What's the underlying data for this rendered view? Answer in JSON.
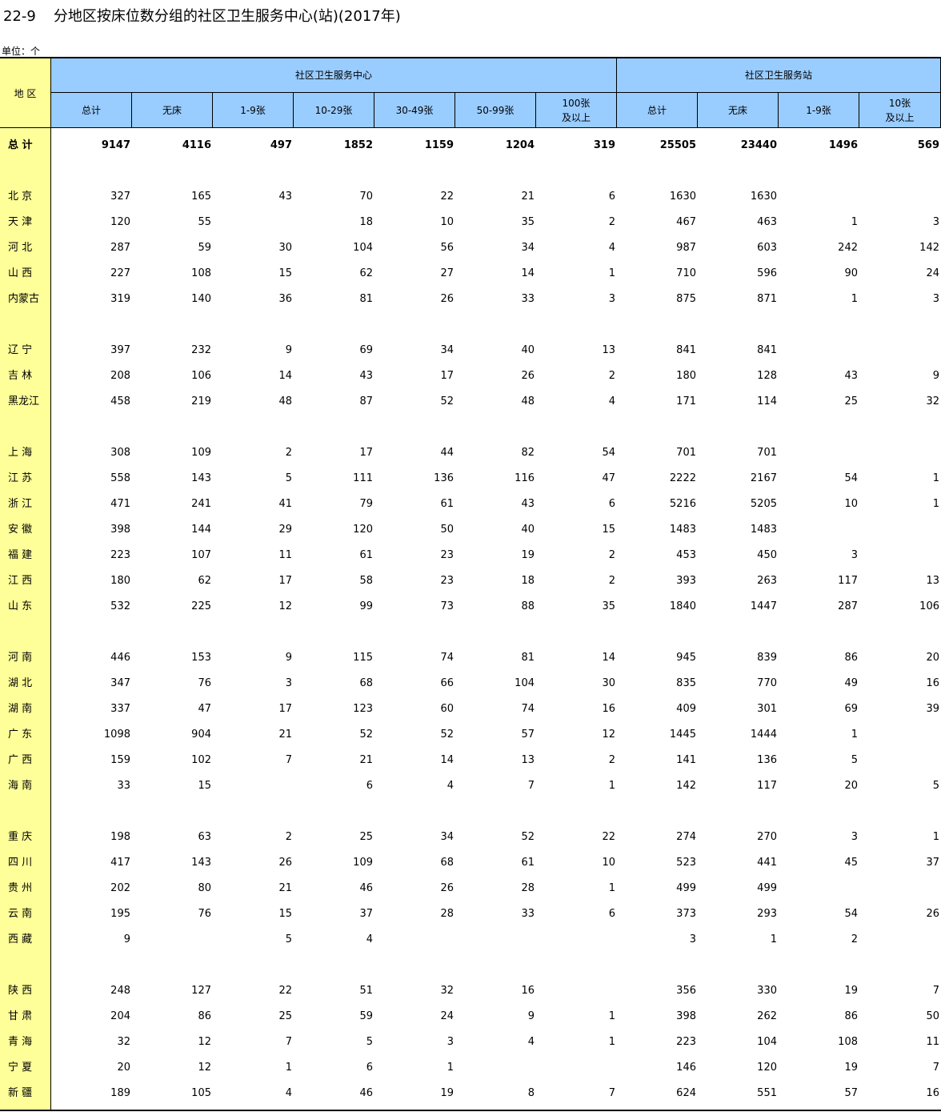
{
  "title": {
    "number": "22-9",
    "text": "分地区按床位数分组的社区卫生服务中心(站)(2017年)"
  },
  "unit": "单位：个",
  "header": {
    "region": "地 区",
    "groups": [
      "社区卫生服务中心",
      "社区卫生服务站"
    ],
    "center_cols": [
      "总计",
      "无床",
      "1-9张",
      "10-29张",
      "30-49张",
      "50-99张",
      "100张\n及以上"
    ],
    "station_cols": [
      "总计",
      "无床",
      "1-9张",
      "10张\n及以上"
    ]
  },
  "rows": [
    {
      "name": "总 计",
      "values": [
        "9147",
        "4116",
        "497",
        "1852",
        "1159",
        "1204",
        "319",
        "25505",
        "23440",
        "1496",
        "569"
      ]
    },
    {
      "name": "北 京",
      "values": [
        "327",
        "165",
        "43",
        "70",
        "22",
        "21",
        "6",
        "1630",
        "1630",
        "",
        ""
      ]
    },
    {
      "name": "天 津",
      "values": [
        "120",
        "55",
        "",
        "18",
        "10",
        "35",
        "2",
        "467",
        "463",
        "1",
        "3"
      ]
    },
    {
      "name": "河 北",
      "values": [
        "287",
        "59",
        "30",
        "104",
        "56",
        "34",
        "4",
        "987",
        "603",
        "242",
        "142"
      ]
    },
    {
      "name": "山 西",
      "values": [
        "227",
        "108",
        "15",
        "62",
        "27",
        "14",
        "1",
        "710",
        "596",
        "90",
        "24"
      ]
    },
    {
      "name": "内蒙古",
      "values": [
        "319",
        "140",
        "36",
        "81",
        "26",
        "33",
        "3",
        "875",
        "871",
        "1",
        "3"
      ]
    },
    {
      "name": "辽 宁",
      "values": [
        "397",
        "232",
        "9",
        "69",
        "34",
        "40",
        "13",
        "841",
        "841",
        "",
        ""
      ]
    },
    {
      "name": "吉 林",
      "values": [
        "208",
        "106",
        "14",
        "43",
        "17",
        "26",
        "2",
        "180",
        "128",
        "43",
        "9"
      ]
    },
    {
      "name": "黑龙江",
      "values": [
        "458",
        "219",
        "48",
        "87",
        "52",
        "48",
        "4",
        "171",
        "114",
        "25",
        "32"
      ]
    },
    {
      "name": "上 海",
      "values": [
        "308",
        "109",
        "2",
        "17",
        "44",
        "82",
        "54",
        "701",
        "701",
        "",
        ""
      ]
    },
    {
      "name": "江 苏",
      "values": [
        "558",
        "143",
        "5",
        "111",
        "136",
        "116",
        "47",
        "2222",
        "2167",
        "54",
        "1"
      ]
    },
    {
      "name": "浙 江",
      "values": [
        "471",
        "241",
        "41",
        "79",
        "61",
        "43",
        "6",
        "5216",
        "5205",
        "10",
        "1"
      ]
    },
    {
      "name": "安 徽",
      "values": [
        "398",
        "144",
        "29",
        "120",
        "50",
        "40",
        "15",
        "1483",
        "1483",
        "",
        ""
      ]
    },
    {
      "name": "福 建",
      "values": [
        "223",
        "107",
        "11",
        "61",
        "23",
        "19",
        "2",
        "453",
        "450",
        "3",
        ""
      ]
    },
    {
      "name": "江 西",
      "values": [
        "180",
        "62",
        "17",
        "58",
        "23",
        "18",
        "2",
        "393",
        "263",
        "117",
        "13"
      ]
    },
    {
      "name": "山 东",
      "values": [
        "532",
        "225",
        "12",
        "99",
        "73",
        "88",
        "35",
        "1840",
        "1447",
        "287",
        "106"
      ]
    },
    {
      "name": "河 南",
      "values": [
        "446",
        "153",
        "9",
        "115",
        "74",
        "81",
        "14",
        "945",
        "839",
        "86",
        "20"
      ]
    },
    {
      "name": "湖 北",
      "values": [
        "347",
        "76",
        "3",
        "68",
        "66",
        "104",
        "30",
        "835",
        "770",
        "49",
        "16"
      ]
    },
    {
      "name": "湖 南",
      "values": [
        "337",
        "47",
        "17",
        "123",
        "60",
        "74",
        "16",
        "409",
        "301",
        "69",
        "39"
      ]
    },
    {
      "name": "广 东",
      "values": [
        "1098",
        "904",
        "21",
        "52",
        "52",
        "57",
        "12",
        "1445",
        "1444",
        "1",
        ""
      ]
    },
    {
      "name": "广 西",
      "values": [
        "159",
        "102",
        "7",
        "21",
        "14",
        "13",
        "2",
        "141",
        "136",
        "5",
        ""
      ]
    },
    {
      "name": "海 南",
      "values": [
        "33",
        "15",
        "",
        "6",
        "4",
        "7",
        "1",
        "142",
        "117",
        "20",
        "5"
      ]
    },
    {
      "name": "重 庆",
      "values": [
        "198",
        "63",
        "2",
        "25",
        "34",
        "52",
        "22",
        "274",
        "270",
        "3",
        "1"
      ]
    },
    {
      "name": "四 川",
      "values": [
        "417",
        "143",
        "26",
        "109",
        "68",
        "61",
        "10",
        "523",
        "441",
        "45",
        "37"
      ]
    },
    {
      "name": "贵 州",
      "values": [
        "202",
        "80",
        "21",
        "46",
        "26",
        "28",
        "1",
        "499",
        "499",
        "",
        ""
      ]
    },
    {
      "name": "云 南",
      "values": [
        "195",
        "76",
        "15",
        "37",
        "28",
        "33",
        "6",
        "373",
        "293",
        "54",
        "26"
      ]
    },
    {
      "name": "西 藏",
      "values": [
        "9",
        "",
        "5",
        "4",
        "",
        "",
        "",
        "3",
        "1",
        "2",
        ""
      ]
    },
    {
      "name": "陕 西",
      "values": [
        "248",
        "127",
        "22",
        "51",
        "32",
        "16",
        "",
        "356",
        "330",
        "19",
        "7"
      ]
    },
    {
      "name": "甘 肃",
      "values": [
        "204",
        "86",
        "25",
        "59",
        "24",
        "9",
        "1",
        "398",
        "262",
        "86",
        "50"
      ]
    },
    {
      "name": "青 海",
      "values": [
        "32",
        "12",
        "7",
        "5",
        "3",
        "4",
        "1",
        "223",
        "104",
        "108",
        "11"
      ]
    },
    {
      "name": "宁 夏",
      "values": [
        "20",
        "12",
        "1",
        "6",
        "1",
        "",
        "",
        "146",
        "120",
        "19",
        "7"
      ]
    },
    {
      "name": "新 疆",
      "values": [
        "189",
        "105",
        "4",
        "46",
        "19",
        "8",
        "7",
        "624",
        "551",
        "57",
        "16"
      ]
    }
  ]
}
